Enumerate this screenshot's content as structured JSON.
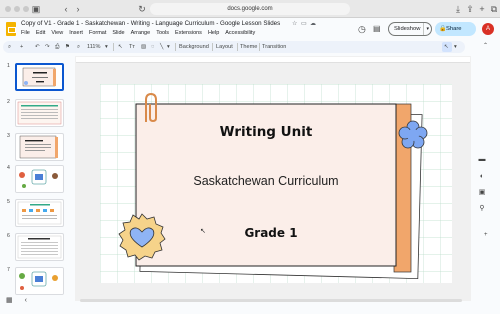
{
  "browser": {
    "url": "docs.google.com",
    "icons": [
      "sidebar-toggle-icon",
      "back-icon",
      "forward-icon",
      "reload-icon",
      "download-icon",
      "share-icon",
      "new-tab-icon",
      "tabs-icon"
    ]
  },
  "app": {
    "title": "Copy of V1 - Grade 1 - Saskatchewan - Writing - Language Curriculum - Google Lesson Slides",
    "menus": [
      "File",
      "Edit",
      "View",
      "Insert",
      "Format",
      "Slide",
      "Arrange",
      "Tools",
      "Extensions",
      "Help",
      "Accessibility"
    ],
    "slideshow_label": "Slideshow",
    "share_label": "Share",
    "avatar_initial": "A",
    "brand_color": "#f4b400",
    "accent_color": "#c2e7ff"
  },
  "toolbar": {
    "zoom": "111%",
    "background_label": "Background",
    "layout_label": "Layout",
    "theme_label": "Theme",
    "transition_label": "Transition"
  },
  "filmstrip": {
    "slides": [
      {
        "number": "1",
        "selected": true
      },
      {
        "number": "2",
        "selected": false
      },
      {
        "number": "3",
        "selected": false
      },
      {
        "number": "4",
        "selected": false
      },
      {
        "number": "5",
        "selected": false
      },
      {
        "number": "6",
        "selected": false
      },
      {
        "number": "7",
        "selected": false
      }
    ],
    "selected_color": "#0b57d0"
  },
  "slide": {
    "title": "Writing Unit",
    "subtitle": "Saskatchewan Curriculum",
    "grade": "Grade 1",
    "card_color": "#fbeee9",
    "tab_color": "#f1a66b",
    "flower_color": "#7ea7f2",
    "heart_color": "#8fb4f5",
    "grid_color": "#b9dcc8"
  }
}
